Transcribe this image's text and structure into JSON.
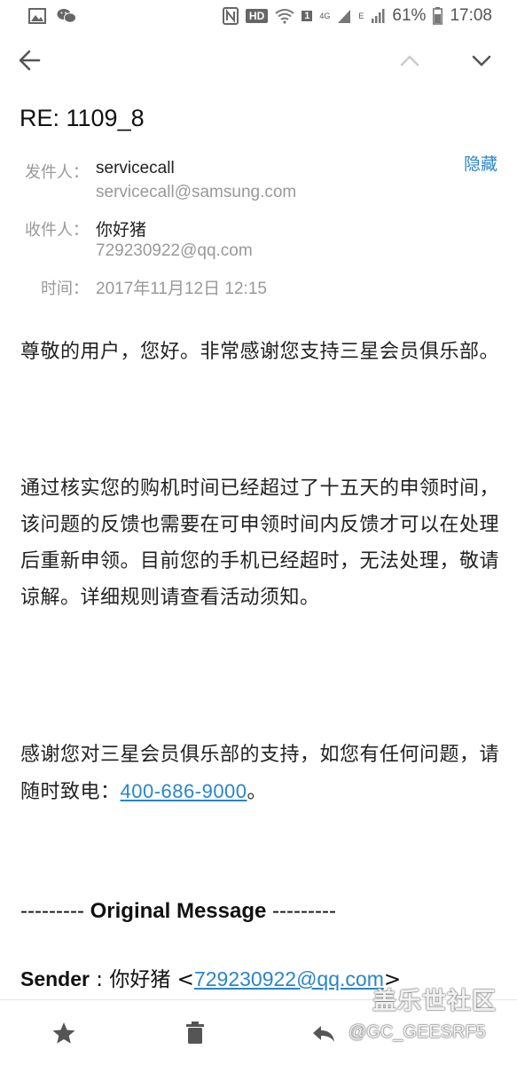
{
  "status_bar": {
    "hd": "HD",
    "sim": "1",
    "network": "4G",
    "network_alt": "E",
    "battery": "61%",
    "time": "17:08",
    "icons": [
      "gallery-icon",
      "wechat-icon",
      "nfc-icon",
      "wifi-icon",
      "signal-icon",
      "battery-icon"
    ]
  },
  "top_bar": {
    "icons": [
      "back-arrow-icon",
      "chevron-up-icon",
      "chevron-down-icon"
    ]
  },
  "email": {
    "subject": "RE: 1109_8",
    "hide_label": "隐藏",
    "sender_label": "发件人：",
    "sender_name": "servicecall",
    "sender_email": "servicecall@samsung.com",
    "recipient_label": "收件人：",
    "recipient_name": "你好猪",
    "recipient_email": "729230922@qq.com",
    "time_label": "时间：",
    "time_value": "2017年11月12日 12:15"
  },
  "body": {
    "para1": "尊敬的用户，您好。非常感谢您支持三星会员俱乐部。",
    "para2": "通过核实您的购机时间已经超过了十五天的申领时间，该问题的反馈也需要在可申领时间内反馈才可以在处理后重新申领。目前您的手机已经超时，无法处理，敬请谅解。详细规则请查看活动须知。",
    "para3_prefix": "感谢您对三星会员俱乐部的支持，如您有任何问题，请随时致电：",
    "phone": "400-686-9000",
    "para3_suffix": "。",
    "orig_dashes_left": "--------- ",
    "orig_title": "Original Message",
    "orig_dashes_right": " ---------",
    "sender_line_label": "Sender",
    "sender_line_sep": " : 你好猪 <",
    "sender_line_email": "729230922@qq.com",
    "sender_line_end": ">"
  },
  "bottom_bar": {
    "icons": [
      "star-icon",
      "trash-icon",
      "reply-icon"
    ]
  },
  "watermark": {
    "main": "盖乐世社区",
    "sub": "@GC_GEESRF5"
  },
  "colors": {
    "link": "#2a85c9",
    "muted": "#999999",
    "text": "#222222"
  }
}
